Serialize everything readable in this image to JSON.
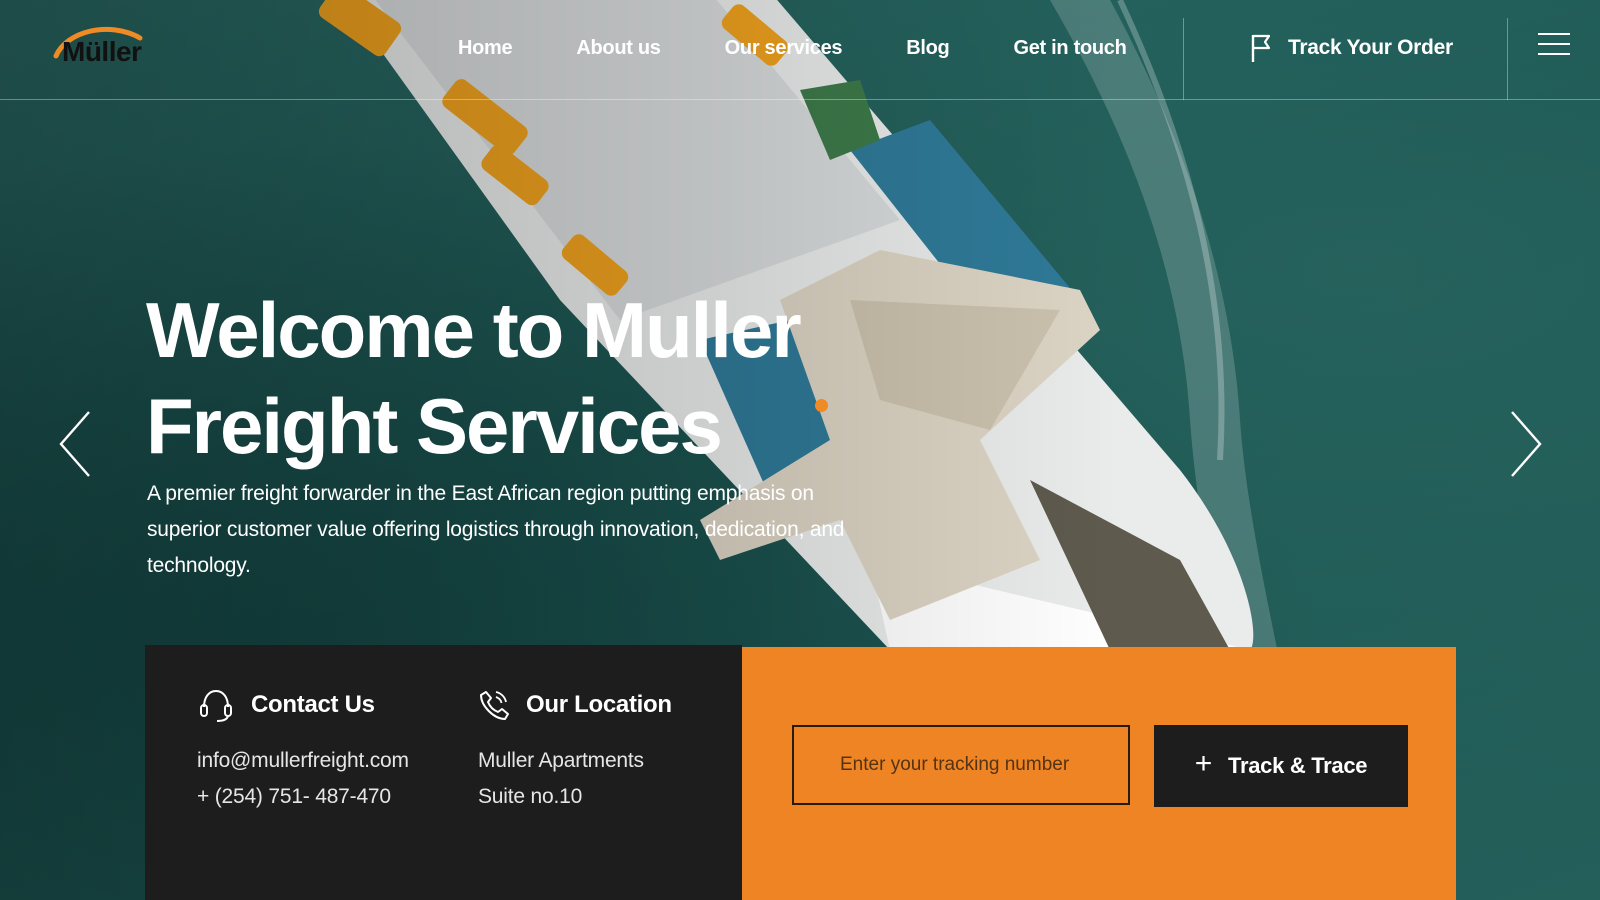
{
  "brand": {
    "name": "Müller",
    "accent": "#f08a24"
  },
  "nav": {
    "items": [
      {
        "label": "Home"
      },
      {
        "label": "About us"
      },
      {
        "label": "Our services"
      },
      {
        "label": "Blog"
      },
      {
        "label": "Get in touch"
      }
    ],
    "track_order": {
      "label": "Track Your Order",
      "icon": "flag-icon"
    },
    "menu_icon": "hamburger-menu-icon"
  },
  "hero": {
    "title_line1": "Welcome to Muller",
    "title_line2": "Freight Services",
    "subtitle": "A premier freight forwarder in the East African region putting emphasis on superior customer value offering logistics through innovation, dedication, and technology.",
    "prev_icon": "chevron-left-icon",
    "next_icon": "chevron-right-icon"
  },
  "contact": {
    "title": "Contact Us",
    "icon": "headset-icon",
    "email": "info@mullerfreight.com",
    "phone": "+ (254) 751- 487-470"
  },
  "location": {
    "title": "Our Location",
    "icon": "phone-icon",
    "line1": "Muller Apartments",
    "line2": "Suite no.10"
  },
  "tracking": {
    "placeholder": "Enter your tracking number",
    "value": "",
    "button_label": "Track & Trace",
    "button_icon": "plus-icon"
  },
  "colors": {
    "orange": "#ef8424",
    "dark": "#1d1d1d",
    "sea": "#1f5a56"
  }
}
